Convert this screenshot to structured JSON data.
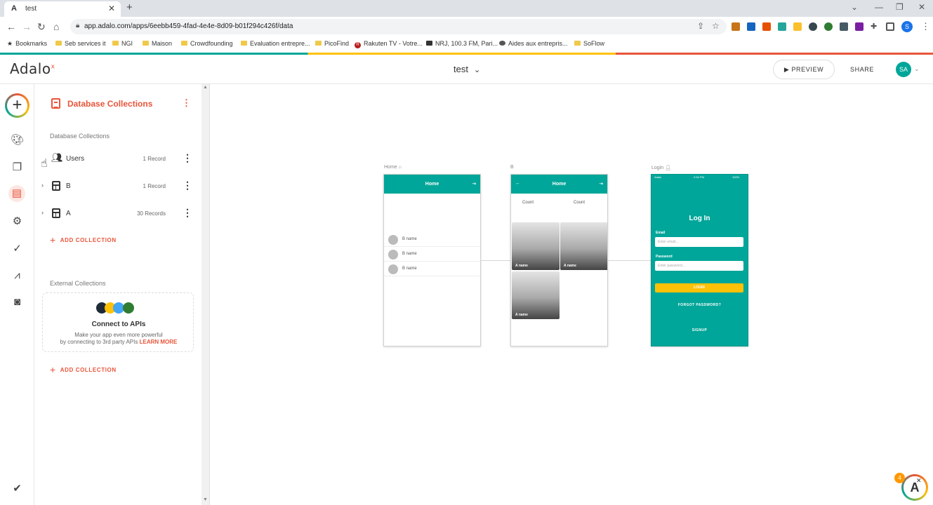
{
  "browser": {
    "tab_title": "test",
    "tab_favicon": "A",
    "url": "app.adalo.com/apps/6eebb459-4fad-4e4e-8d09-b01f294c426f/data",
    "bookmarks": [
      {
        "label": "Bookmarks",
        "icon": "star-icon"
      },
      {
        "label": "Seb services it",
        "icon": "folder-icon"
      },
      {
        "label": "NGI",
        "icon": "folder-icon"
      },
      {
        "label": "Maison",
        "icon": "folder-icon"
      },
      {
        "label": "Crowdfounding",
        "icon": "folder-icon"
      },
      {
        "label": "Evaluation entrepre...",
        "icon": "folder-icon"
      },
      {
        "label": "PicoFind",
        "icon": "folder-icon"
      },
      {
        "label": "Rakuten TV - Votre...",
        "icon": "rakuten-icon"
      },
      {
        "label": "NRJ, 100.3 FM, Pari...",
        "icon": "radio-icon"
      },
      {
        "label": "Aides aux entrepris...",
        "icon": "globe-icon"
      },
      {
        "label": "SoFlow",
        "icon": "folder-icon"
      }
    ],
    "profile_initial": "S"
  },
  "header": {
    "logo": "Adalo",
    "app_name": "test",
    "preview_label": "PREVIEW",
    "share_label": "SHARE",
    "avatar_initials": "SA",
    "accent": "#e8553a",
    "teal": "#00a699"
  },
  "panel": {
    "title": "Database Collections",
    "section_label": "Database Collections",
    "collections": [
      {
        "name": "Users",
        "count": "1 Record"
      },
      {
        "name": "B",
        "count": "1 Record"
      },
      {
        "name": "A",
        "count": "30 Records"
      }
    ],
    "add_collection_label": "ADD COLLECTION",
    "external_label": "External Collections",
    "api_title": "Connect to APIs",
    "api_desc_1": "Make your app even more powerful",
    "api_desc_2": "by connecting to 3rd party APIs",
    "learn_more": "LEARN MORE",
    "add_collection_label_2": "ADD COLLECTION"
  },
  "canvas": {
    "screens": [
      {
        "label": "Home",
        "header_title": "Home",
        "items": [
          "B name",
          "B name",
          "B name"
        ]
      },
      {
        "label": "B",
        "header_title": "Home",
        "count_left": "Count",
        "count_right": "Count",
        "tile_label": "A name"
      },
      {
        "label": "Login",
        "title": "Log In",
        "carrier": "Adalo",
        "time": "2:54 PM",
        "battery": "100%",
        "email_label": "Email",
        "email_placeholder": "Enter email...",
        "password_label": "Password",
        "password_placeholder": "Enter password...",
        "login_button": "LOGIN",
        "forgot": "FORGOT PASSWORD?",
        "signup": "SIGNUP"
      }
    ]
  },
  "fab": {
    "badge": "4"
  }
}
